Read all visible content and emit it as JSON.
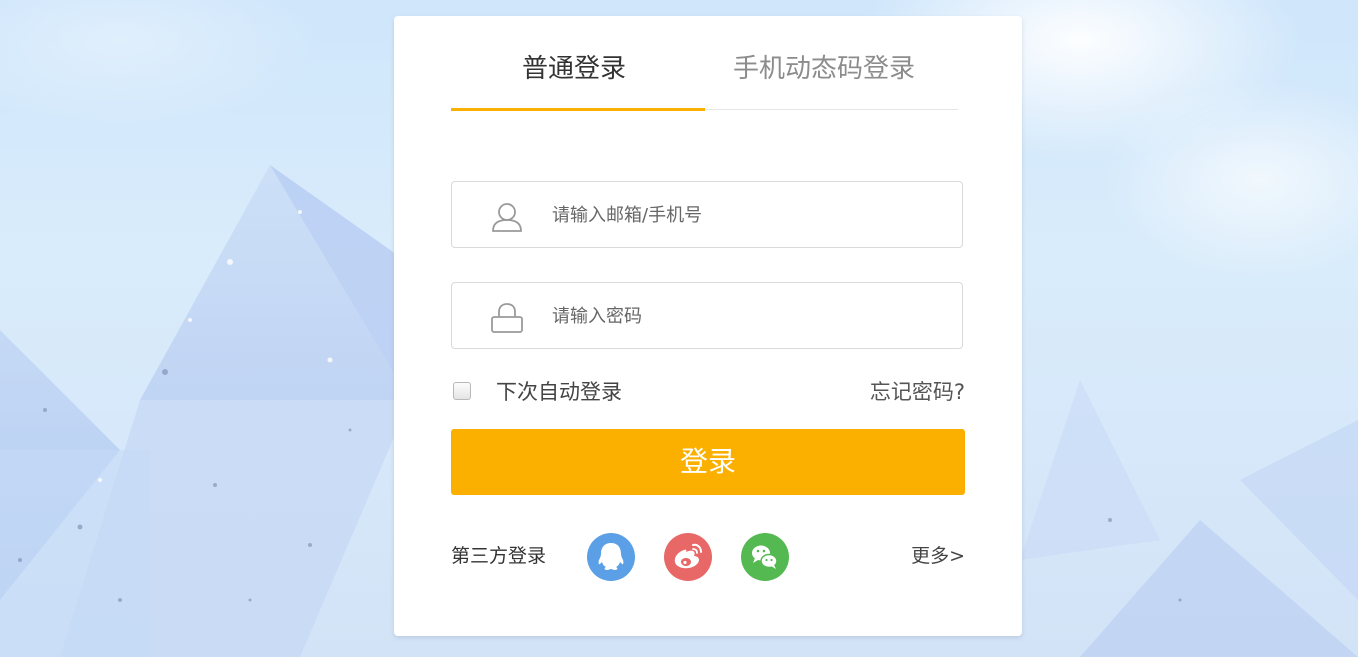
{
  "tabs": [
    {
      "label": "普通登录",
      "active": true
    },
    {
      "label": "手机动态码登录",
      "active": false
    }
  ],
  "form": {
    "email_placeholder": "请输入邮箱/手机号",
    "password_placeholder": "请输入密码",
    "remember_label": "下次自动登录",
    "remember_checked": false,
    "forgot_label": "忘记密码?",
    "login_label": "登录"
  },
  "third_party": {
    "label": "第三方登录",
    "icons": [
      "qq-icon",
      "weibo-icon",
      "wechat-icon"
    ],
    "more_label": "更多>"
  },
  "colors": {
    "accent": "#fbb000",
    "qq": "#5b9fe6",
    "weibo": "#e86767",
    "wechat": "#54b951"
  }
}
